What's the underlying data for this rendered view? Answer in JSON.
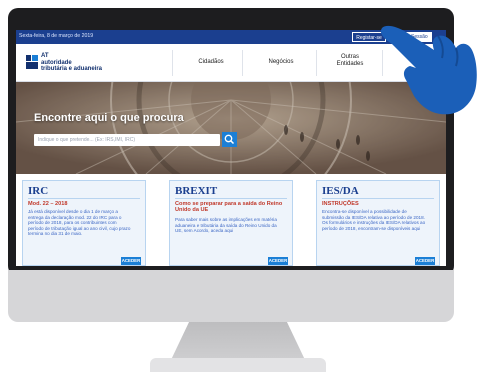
{
  "topbar": {
    "date": "Sexta-feira, 8 de março de 2019",
    "register_label": "Registar-se",
    "login_label": "Iniciar Sessão"
  },
  "header": {
    "logo_line1": "AT",
    "logo_line2": "autoridade",
    "logo_line3": "tributária e aduaneira",
    "nav": [
      {
        "label": "Cidadãos"
      },
      {
        "label": "Negócios"
      },
      {
        "label_line1": "Outras",
        "label_line2": "Entidades"
      }
    ]
  },
  "hero": {
    "title": "Encontre aqui o que procura",
    "search_placeholder": "Indique o que pretende... (Ex: IRS,IMI, IRC)"
  },
  "cards": [
    {
      "title": "IRC",
      "subtitle": "Mod. 22 – 2018",
      "body": "Já está disponível desde o dia 1 de março a entrega da declaração mod. 22 do IRC para o período de 2018, para os contribuintes com período de tributação igual ao ano civil, cujo prazo termina no dia 31 de maio.",
      "button": "ACEDER"
    },
    {
      "title": "BREXIT",
      "subtitle": "Como se preparar para a saída do Reino Unido da UE",
      "body": "Para saber mais sobre as implicações em matéria aduaneira e tributária da saída do Reino Unido da UE, sem Acordo, aceda aqui",
      "button": "ACEDER"
    },
    {
      "title": "IES/DA",
      "subtitle": "INSTRUÇÕES",
      "body": "Encontra-se disponível a possibilidade de submissão da IES/DA relativa ao período de 2018. Os formulários e instruções da IES/DA relativos ao período de 2018, encontram-se disponíveis aqui",
      "button": "ACEDER"
    }
  ],
  "colors": {
    "brand_blue": "#1b3f8f",
    "accent_blue": "#1b7fd6",
    "card_subtitle_red": "#c0392b"
  }
}
